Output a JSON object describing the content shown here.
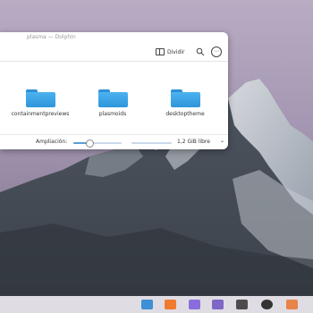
{
  "window": {
    "title": "plasma — Dolphin"
  },
  "toolbar": {
    "split_label": "Dividir",
    "split_icon": "split-view-icon",
    "search_icon": "search-icon",
    "menu_icon": "more-options-icon",
    "menu_glyph": "⋯"
  },
  "files": [
    {
      "name": "containmentpreviews",
      "icon": "folder-icon"
    },
    {
      "name": "plasmoids",
      "icon": "folder-icon"
    },
    {
      "name": "desktoptheme",
      "icon": "folder-icon"
    }
  ],
  "statusbar": {
    "zoom_label": "Ampliación:",
    "zoom_level": 0.33,
    "free_space": "1,2 GiB libre",
    "chevron": "⌄"
  },
  "taskbar": {
    "apps": [
      {
        "name": "discover-icon",
        "color": "#3d8fd8"
      },
      {
        "name": "orange-app-icon",
        "color": "#f07a2e"
      },
      {
        "name": "purple-app-icon",
        "color": "#8a6ddc"
      },
      {
        "name": "wallpaper-app-icon",
        "color": "#7f67c6"
      },
      {
        "name": "file-manager-icon",
        "color": "#4c4c4c"
      },
      {
        "name": "terminal-icon",
        "color": "#333333"
      },
      {
        "name": "tray-folder-icon",
        "color": "#e8844a"
      }
    ]
  },
  "colors": {
    "accent": "#3daee9",
    "folder": "#2f95da"
  }
}
